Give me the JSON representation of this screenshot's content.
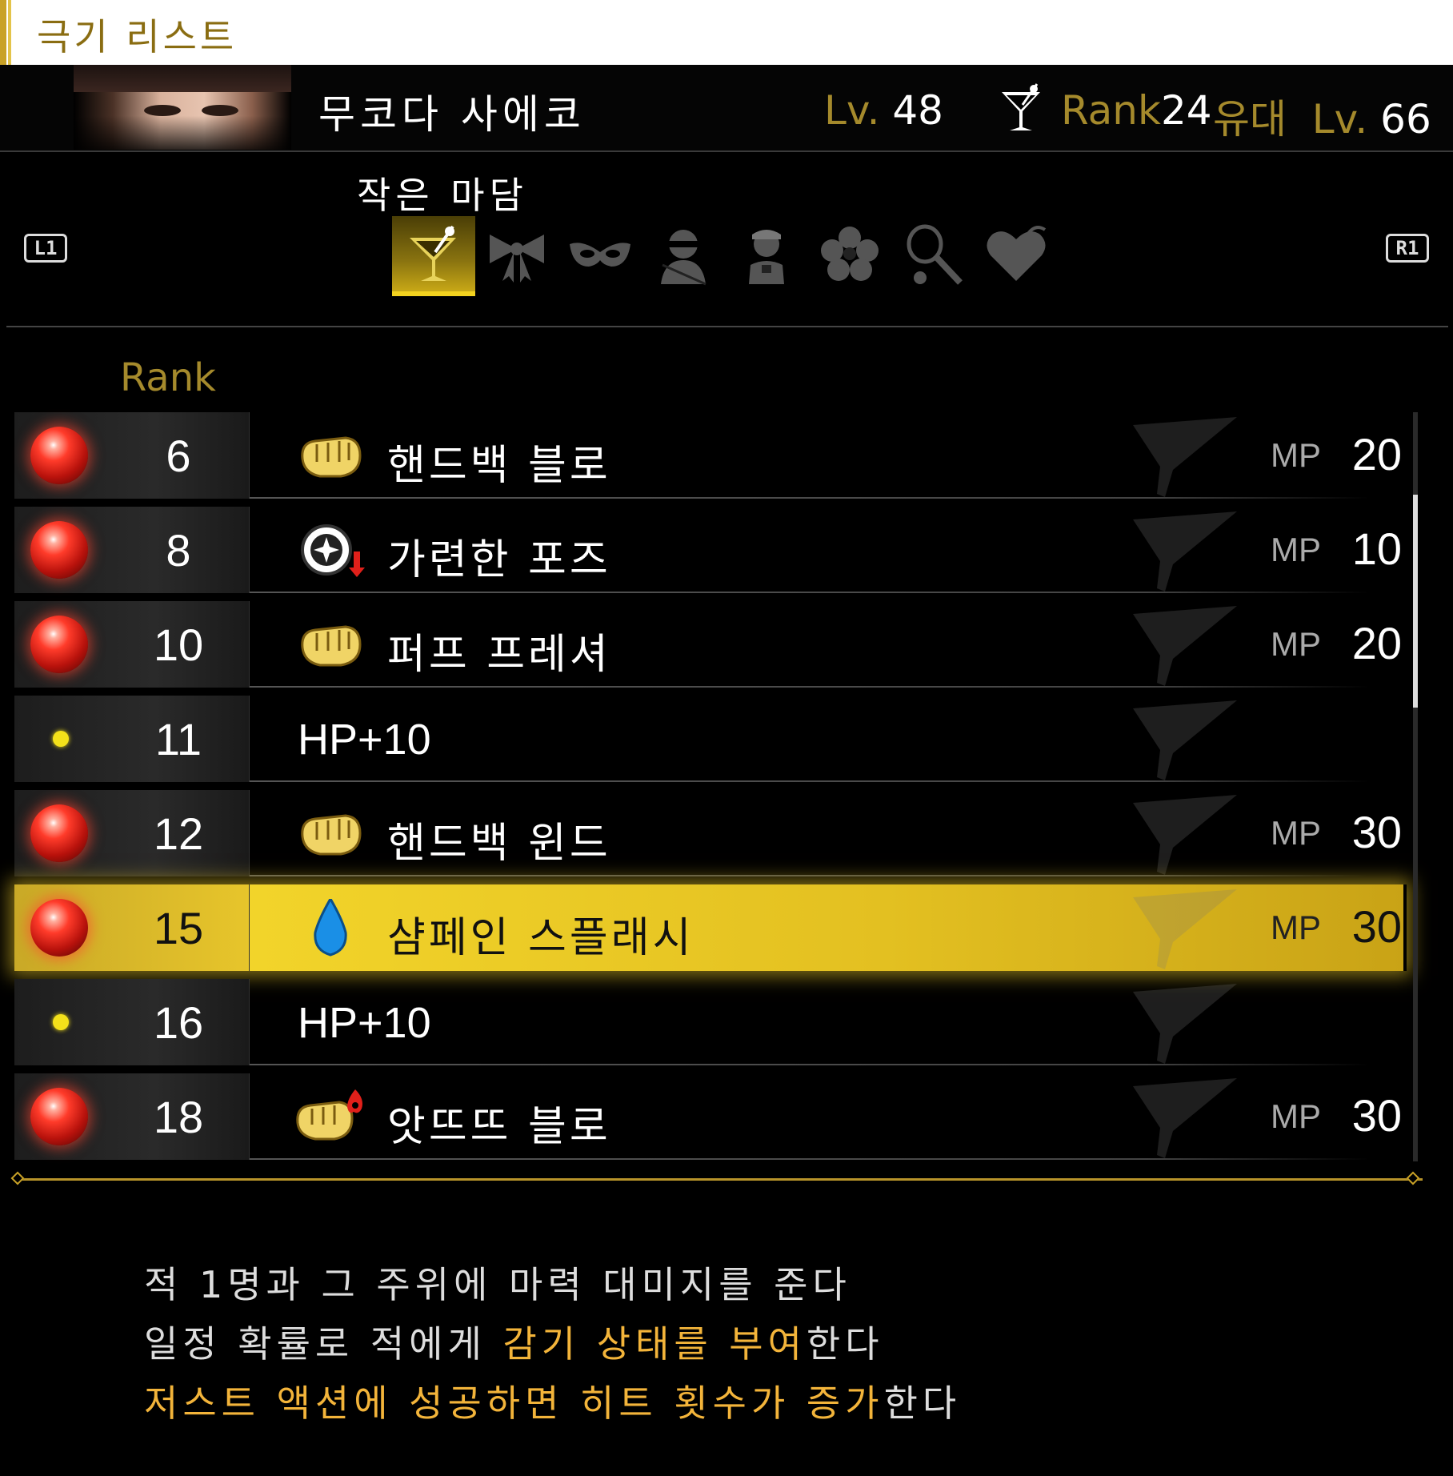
{
  "window": {
    "title": "극기 리스트"
  },
  "character": {
    "name": "무코다 사에코",
    "lv_label": "Lv.",
    "lv_value": "48",
    "rank_label": "Rank",
    "rank_value": "24",
    "bond_label": "유대",
    "bond_lv_label": "Lv.",
    "bond_lv_value": "66"
  },
  "category": {
    "current_label": "작은 마담",
    "left_button": "L1",
    "right_button": "R1",
    "tabs": [
      {
        "icon": "cocktail-icon",
        "active": true
      },
      {
        "icon": "ribbon-icon",
        "active": false
      },
      {
        "icon": "mask-icon",
        "active": false
      },
      {
        "icon": "ninja-icon",
        "active": false
      },
      {
        "icon": "maid-icon",
        "active": false
      },
      {
        "icon": "hibiscus-icon",
        "active": false
      },
      {
        "icon": "tennis-icon",
        "active": false
      },
      {
        "icon": "heart-icon",
        "active": false
      }
    ]
  },
  "list": {
    "rank_header": "Rank",
    "mp_label": "MP",
    "rows": [
      {
        "rank": "6",
        "type": "skill",
        "icon": "fist-icon",
        "name": "핸드백 블로",
        "mp": "20"
      },
      {
        "rank": "8",
        "type": "skill",
        "icon": "pose-debuff-icon",
        "name": "가련한 포즈",
        "mp": "10"
      },
      {
        "rank": "10",
        "type": "skill",
        "icon": "fist-icon",
        "name": "퍼프 프레셔",
        "mp": "20"
      },
      {
        "rank": "11",
        "type": "stat",
        "icon": "",
        "name": "HP+10",
        "mp": ""
      },
      {
        "rank": "12",
        "type": "skill",
        "icon": "fist-icon",
        "name": "핸드백 윈드",
        "mp": "30"
      },
      {
        "rank": "15",
        "type": "skill",
        "icon": "water-drop-icon",
        "name": "샴페인 스플래시",
        "mp": "30",
        "selected": true
      },
      {
        "rank": "16",
        "type": "stat",
        "icon": "",
        "name": "HP+10",
        "mp": ""
      },
      {
        "rank": "18",
        "type": "skill",
        "icon": "fist-fire-icon",
        "name": "앗뜨뜨 블로",
        "mp": "30"
      }
    ]
  },
  "description": {
    "line1": "적 1명과 그 주위에 마력 대미지를 준다",
    "line2_plain": "일정 확률로 적에게 ",
    "line2_hl": "감기 상태를 부여",
    "line2_tail": "한다",
    "line3_hl": "저스트 액션에 성공하면 히트 횟수가 증가",
    "line3_tail": "한다"
  },
  "colors": {
    "accent_gold": "#a58a2c",
    "selection_yellow": "#f2d42a",
    "highlight_orange": "#f3b43a",
    "orb_red": "#ff3b2a"
  }
}
